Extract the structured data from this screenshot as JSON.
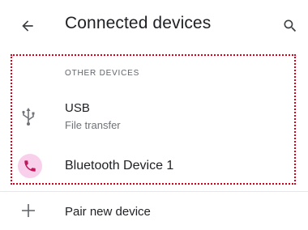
{
  "app_bar": {
    "title": "Connected devices",
    "back_icon": "arrow-back-icon",
    "search_icon": "search-icon"
  },
  "other_devices": {
    "header": "OTHER DEVICES",
    "usb": {
      "title": "USB",
      "subtitle": "File transfer",
      "icon": "usb-icon"
    },
    "bluetooth": {
      "title": "Bluetooth Device 1",
      "icon": "phone-icon",
      "icon_bg_color": "#f9d0ec",
      "icon_color": "#c2185b"
    }
  },
  "pair": {
    "label": "Pair new device",
    "icon": "plus-icon"
  },
  "colors": {
    "highlight_border": "#d0021b",
    "text_primary": "#202124",
    "text_secondary": "#5f6368"
  }
}
